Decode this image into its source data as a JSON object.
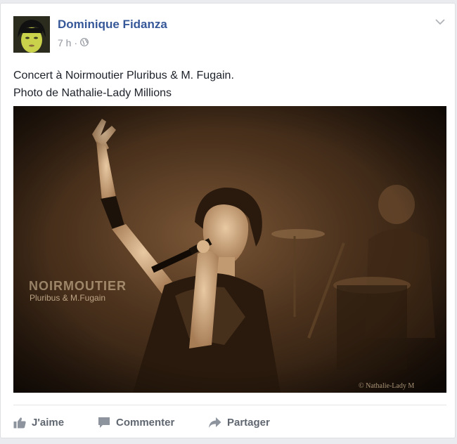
{
  "post": {
    "author": "Dominique Fidanza",
    "time": "7 h",
    "separator": "·",
    "privacy_icon": "globe-icon",
    "menu_icon": "chevron-down-icon",
    "text_line1": "Concert à Noirmoutier Pluribus & M. Fugain.",
    "text_line2": "Photo de Nathalie-Lady Millions",
    "photo": {
      "overlay_title": "NOIRMOUTIER",
      "overlay_subtitle": "Pluribus & M.Fugain",
      "credit": "© Nathalie-Lady M"
    }
  },
  "actions": {
    "like": "J'aime",
    "comment": "Commenter",
    "share": "Partager"
  },
  "colors": {
    "author_link": "#365899",
    "meta_text": "#90949c",
    "body_text": "#1d2129",
    "action_text": "#606770",
    "photo_tone": "#6b4a2c"
  }
}
